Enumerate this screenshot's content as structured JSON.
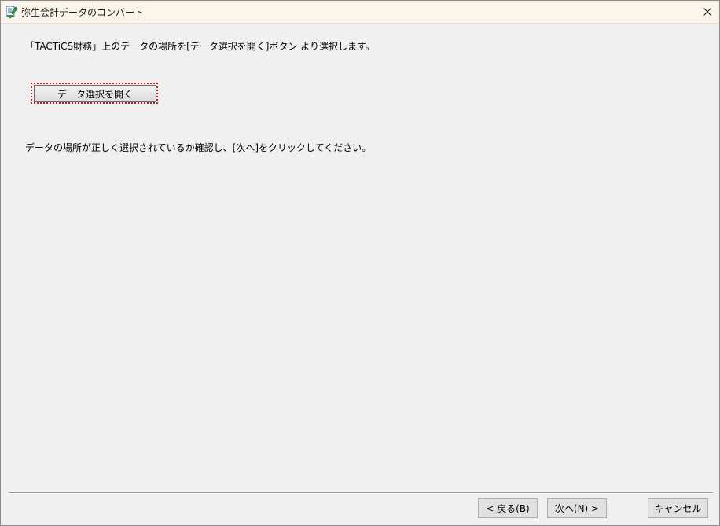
{
  "window": {
    "title": "弥生会計データのコンバート",
    "app_icon": "yayoi-app-icon",
    "close_icon": "close-icon"
  },
  "content": {
    "instruction_1": "「TACTiCS財務」上のデータの場所を[データ選択を開く]ボタン より選択します。",
    "open_button_label": "データ選択を開く",
    "instruction_2": "データの場所が正しく選択されているか確認し、[次へ]をクリックしてください。"
  },
  "footer": {
    "back_label": "< 戻る(",
    "back_key": "B",
    "back_suffix": ")",
    "next_label": "次へ(",
    "next_key": "N",
    "next_suffix": ") >",
    "cancel_label": "キャンセル"
  },
  "colors": {
    "focus_ring": "#d4181a",
    "titlebar": "#fbf5ec",
    "background": "#f0f0f0"
  }
}
